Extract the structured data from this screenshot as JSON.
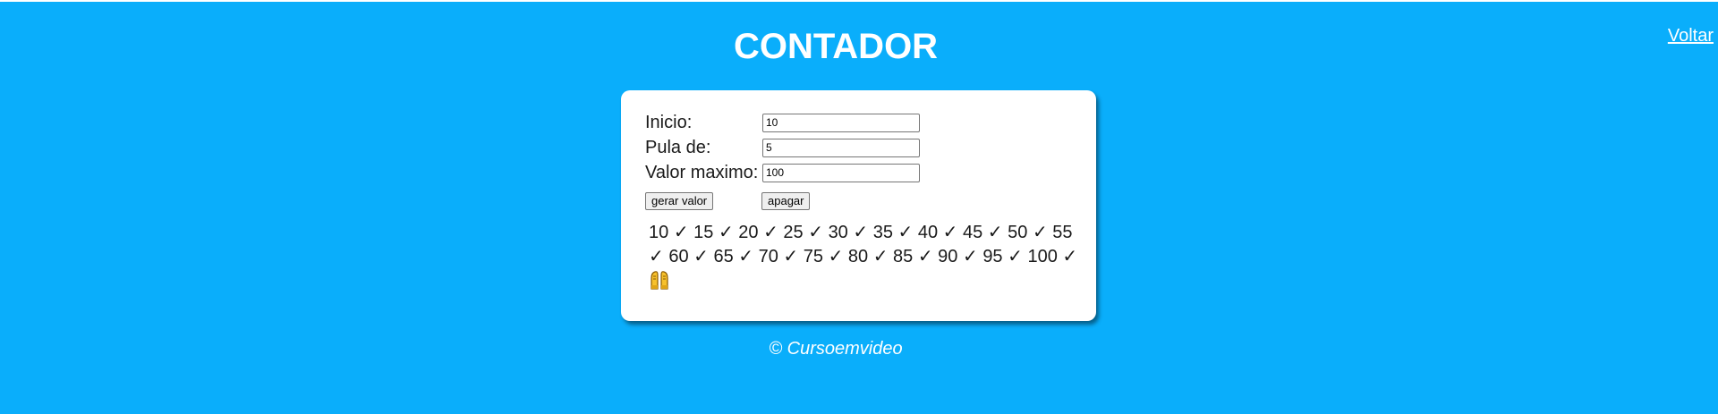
{
  "header": {
    "title": "CONTADOR",
    "back_link": "Voltar"
  },
  "form": {
    "start": {
      "label": "Inicio:",
      "value": "10"
    },
    "step": {
      "label": "Pula de:",
      "value": "5"
    },
    "max": {
      "label": "Valor maximo:",
      "value": "100"
    },
    "generate_button": "gerar valor",
    "clear_button": "apagar"
  },
  "result": {
    "values": [
      "10",
      "15",
      "20",
      "25",
      "30",
      "35",
      "40",
      "45",
      "50",
      "55",
      "60",
      "65",
      "70",
      "75",
      "80",
      "85",
      "90",
      "95",
      "100"
    ],
    "separator": "✓",
    "end_icon": "raising-hands-icon"
  },
  "footer": {
    "copyright": "© Cursoemvideo"
  },
  "colors": {
    "background": "#0aaefb",
    "card": "#ffffff",
    "text": "#1a1a1a"
  }
}
